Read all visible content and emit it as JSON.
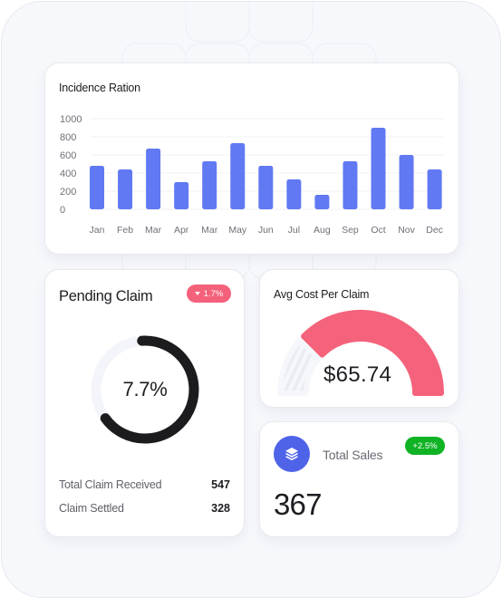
{
  "colors": {
    "bar": "#6179f2",
    "gauge_fill": "#f4637b",
    "donut_fill": "#1c1c1e",
    "donut_track": "#f4f5fa",
    "badge_negative": "#f4617a",
    "badge_positive": "#0fb324",
    "sales_icon_bg": "#4f63e8"
  },
  "incidence": {
    "title": "Incidence Ration",
    "chart_data": {
      "type": "bar",
      "title": "Incidence Ration",
      "categories": [
        "Jan",
        "Feb",
        "Mar",
        "Apr",
        "Mar",
        "May",
        "Jun",
        "Jul",
        "Aug",
        "Sep",
        "Oct",
        "Nov",
        "Dec"
      ],
      "values": [
        480,
        440,
        670,
        300,
        530,
        730,
        480,
        330,
        160,
        530,
        900,
        600,
        440
      ],
      "ylim": [
        0,
        1000
      ],
      "yticks": [
        0,
        200,
        400,
        600,
        800,
        1000
      ],
      "ytick_labels": [
        "0",
        "200",
        "400",
        "600",
        "800",
        "1000"
      ],
      "xlabel": "",
      "ylabel": "",
      "grid": true,
      "legend": "none"
    }
  },
  "pending": {
    "title": "Pending Claim",
    "badge": "1.7%",
    "badge_icon": "triangle-down-icon",
    "donut_label": "7.7%",
    "donut_fill_fraction": 0.66,
    "stats": [
      {
        "label": "Total Claim Received",
        "value": "547"
      },
      {
        "label": "Claim Settled",
        "value": "328"
      }
    ]
  },
  "avg_cost": {
    "title": "Avg Cost Per Claim",
    "value": "$65.74",
    "gauge_fill_fraction": 0.75
  },
  "sales": {
    "title": "Total Sales",
    "icon": "layers-icon",
    "badge": "+2.5%",
    "value": "367"
  }
}
